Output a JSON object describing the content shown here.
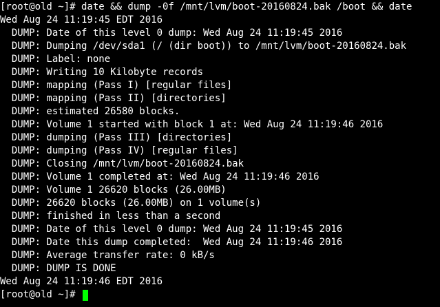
{
  "terminal": {
    "command_line": "[root@old ~]# date && dump -0f /mnt/lvm/boot-20160824.bak /boot && date",
    "date_start": "Wed Aug 24 11:19:45 EDT 2016",
    "dump_lines": [
      "  DUMP: Date of this level 0 dump: Wed Aug 24 11:19:45 2016",
      "  DUMP: Dumping /dev/sda1 (/ (dir boot)) to /mnt/lvm/boot-20160824.bak",
      "  DUMP: Label: none",
      "  DUMP: Writing 10 Kilobyte records",
      "  DUMP: mapping (Pass I) [regular files]",
      "  DUMP: mapping (Pass II) [directories]",
      "  DUMP: estimated 26580 blocks.",
      "  DUMP: Volume 1 started with block 1 at: Wed Aug 24 11:19:46 2016",
      "  DUMP: dumping (Pass III) [directories]",
      "  DUMP: dumping (Pass IV) [regular files]",
      "  DUMP: Closing /mnt/lvm/boot-20160824.bak",
      "  DUMP: Volume 1 completed at: Wed Aug 24 11:19:46 2016",
      "  DUMP: Volume 1 26620 blocks (26.00MB)",
      "  DUMP: 26620 blocks (26.00MB) on 1 volume(s)",
      "  DUMP: finished in less than a second",
      "  DUMP: Date of this level 0 dump: Wed Aug 24 11:19:45 2016",
      "  DUMP: Date this dump completed:  Wed Aug 24 11:19:46 2016",
      "  DUMP: Average transfer rate: 0 kB/s",
      "  DUMP: DUMP IS DONE"
    ],
    "date_end": "Wed Aug 24 11:19:46 EDT 2016",
    "final_prompt": "[root@old ~]# ",
    "colors": {
      "background": "#000000",
      "foreground": "#ffffff",
      "cursor": "#00ff00"
    }
  }
}
